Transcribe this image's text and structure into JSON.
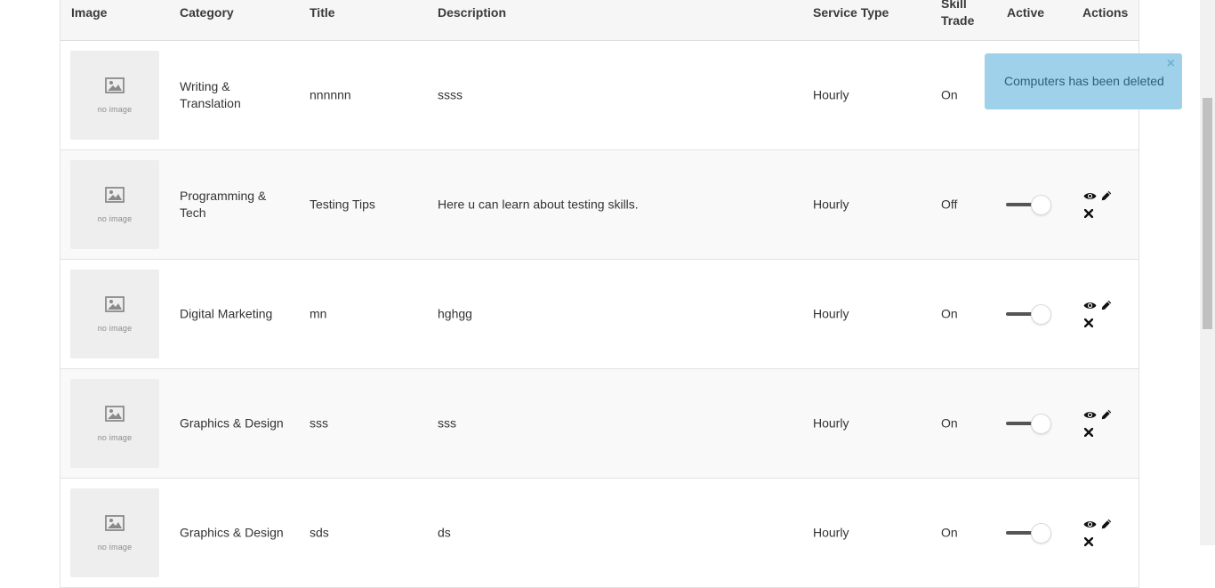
{
  "columns": {
    "image": "Image",
    "category": "Category",
    "title": "Title",
    "description": "Description",
    "service_type": "Service Type",
    "skill_trade_line1": "Skill",
    "skill_trade_line2": "Trade",
    "active": "Active",
    "actions": "Actions"
  },
  "no_image_text": "no image",
  "rows": [
    {
      "category_line1": "Writing &",
      "category_line2": "Translation",
      "title": "nnnnnn",
      "description": "ssss",
      "service_type": "Hourly",
      "skill_trade": "On",
      "active": true
    },
    {
      "category_line1": "Programming &",
      "category_line2": "Tech",
      "title": "Testing Tips",
      "description": "Here u can learn about testing skills.",
      "service_type": "Hourly",
      "skill_trade": "Off",
      "active": true
    },
    {
      "category_line1": "Digital Marketing",
      "category_line2": "",
      "title": "mn",
      "description": "hghgg",
      "service_type": "Hourly",
      "skill_trade": "On",
      "active": true
    },
    {
      "category_line1": "Graphics & Design",
      "category_line2": "",
      "title": "sss",
      "description": "sss",
      "service_type": "Hourly",
      "skill_trade": "On",
      "active": true
    },
    {
      "category_line1": "Graphics & Design",
      "category_line2": "",
      "title": "sds",
      "description": "ds",
      "service_type": "Hourly",
      "skill_trade": "On",
      "active": true
    }
  ],
  "toast": {
    "message": "Computers has been deleted",
    "close_glyph": "×",
    "color": "#9fd2ea"
  },
  "icons": {
    "view": "eye-icon",
    "edit": "pencil-icon",
    "delete": "close-icon",
    "placeholder": "image-icon"
  }
}
